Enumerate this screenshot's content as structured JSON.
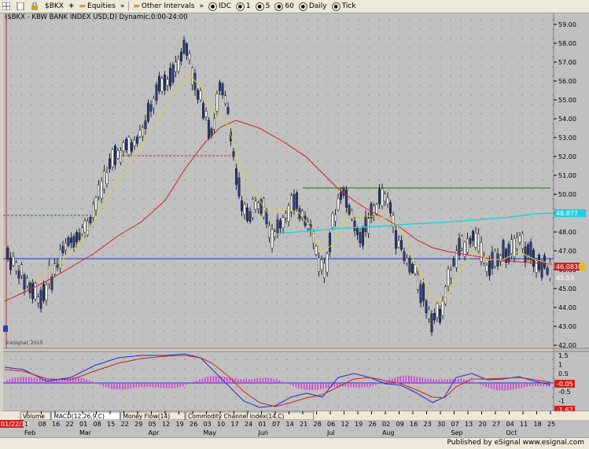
{
  "toolbar": {
    "symbol": "$BKX",
    "category": "Equities",
    "interval_menu": "Other Intervals",
    "idc": "IDC",
    "i1": "1",
    "i5": "5",
    "i60": "60",
    "daily": "Daily",
    "tick": "Tick"
  },
  "chart": {
    "title": "($BKX - KBW BANK INDEX USD,D) Dynamic,0:00-24:00",
    "price_ticks": [
      "59.00",
      "58.00",
      "57.00",
      "56.00",
      "55.00",
      "54.00",
      "53.00",
      "52.00",
      "51.00",
      "50.00",
      "49.00",
      "48.00",
      "47.00",
      "46.00",
      "45.00",
      "44.00",
      "43.00",
      "42.00"
    ],
    "macd_ticks": [
      "1.5",
      "1",
      "0.5",
      "0",
      "-0.5",
      "-1",
      "-1.5"
    ],
    "price_tag": "46.0838",
    "cyan_tag": "48.877",
    "small_tag": "45.53",
    "macd_tag1": "-0.05",
    "macd_tag2": "-1.67",
    "watermark": "©eSignal, 2010",
    "date_tag": "01/22/10"
  },
  "tabs": [
    "Volume",
    "MACD(12,26,9,C)",
    "Money Flow(14)",
    "Commodity Channel Index(14,C)"
  ],
  "x_axis": {
    "days": [
      "1",
      "08",
      "16",
      "22",
      "01",
      "08",
      "15",
      "22",
      "29",
      "05",
      "12",
      "19",
      "26",
      "03",
      "10",
      "17",
      "24",
      "01",
      "07",
      "14",
      "21",
      "28",
      "06",
      "12",
      "19",
      "26",
      "02",
      "09",
      "16",
      "23",
      "30",
      "07",
      "13",
      "20",
      "27",
      "04",
      "11",
      "18",
      "25"
    ],
    "months": [
      "Feb",
      "Mar",
      "Apr",
      "May",
      "Jun",
      "Jul",
      "Aug",
      "Sep",
      "Oct"
    ]
  },
  "footer": {
    "published": "Published by eSignal",
    "url": "www.esignal.com"
  }
}
